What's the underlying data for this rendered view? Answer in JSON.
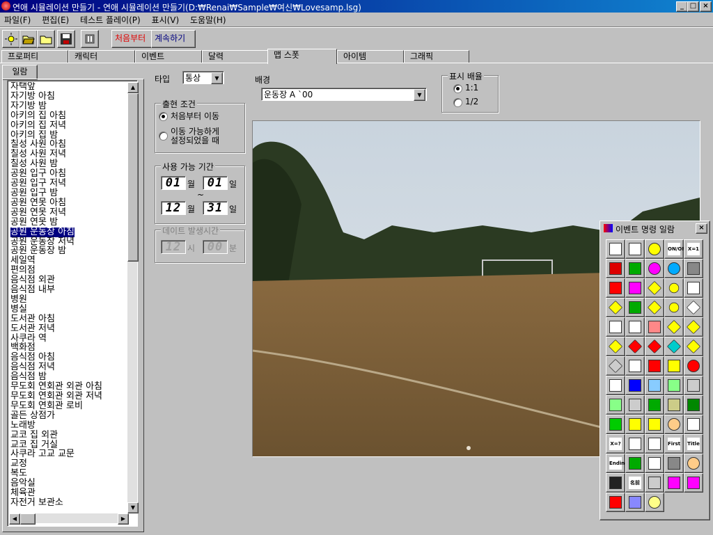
{
  "window": {
    "title": "연애 시뮬레이션 만들기 - 연애 시뮬레이션 만들기(D:₩Renai₩Sample₩여신₩Lovesamp.lsg)"
  },
  "menu": [
    "파일(F)",
    "편집(E)",
    "테스트 플레이(P)",
    "표시(V)",
    "도움말(H)"
  ],
  "toolbar": {
    "start_label": "처음부터",
    "continue_label": "계속하기"
  },
  "tabs": [
    "프로퍼티",
    "캐릭터",
    "이벤트",
    "달력",
    "맵 스폿",
    "아이템",
    "그래픽"
  ],
  "list_tab": "일람",
  "list_items": [
    "자택앞",
    "자기방 아침",
    "자기방 밤",
    "아키의 집 아침",
    "아키의 집 저녁",
    "아키의 집 밤",
    "칠성 사원 아침",
    "칠성 사원 저녁",
    "칠성 사원 밤",
    "공원 입구 아침",
    "공원 입구 저녁",
    "공원 입구 밤",
    "공원 연못 아침",
    "공원 연못 저녁",
    "공원 연못 밤",
    "공원 운동장 아침",
    "공원 운동장 저녁",
    "공원 운동장 밤",
    "세일역",
    "편의점",
    "음식점 외관",
    "음식점 내부",
    "병원",
    "병실",
    "도서관 아침",
    "도서관 저녁",
    "사쿠라 역",
    "백화점",
    "음식점 아침",
    "음식점 저녁",
    "음식점 밤",
    "무도회 연회관 외관 아침",
    "무도회 연회관 외관 저녁",
    "무도회 연회관 로비",
    "골든 상점가",
    "노래방",
    "교코 집 외관",
    "교코 집 거실",
    "사쿠라 고교 교문",
    "교정",
    "복도",
    "음악실",
    "체육관",
    "자전거 보관소"
  ],
  "selected_index": 15,
  "type": {
    "label": "타입",
    "value": "통상"
  },
  "appear": {
    "title": "출현 조건",
    "opt1": "처음부터 이동",
    "opt2a": "이동 가능하게",
    "opt2b": "설정되었을 때",
    "selected": 1
  },
  "period": {
    "title": "사용 가능 기간",
    "start_month": "01",
    "start_day": "01",
    "end_month": "12",
    "end_day": "31",
    "month_unit": "월",
    "day_unit": "일",
    "tilde": "~"
  },
  "date_time": {
    "title": "데이트 발생시간",
    "hour": "12",
    "minute": "00",
    "hour_unit": "시",
    "minute_unit": "분"
  },
  "background": {
    "label": "배경",
    "value": "운동장 A `00"
  },
  "scale": {
    "title": "표시 배율",
    "opt1": "1:1",
    "opt2": "1/2",
    "selected": 1
  },
  "event_window": {
    "title": "이벤트 명령 일람"
  },
  "event_icon_labels": {
    "onoff": "ON/OFF",
    "x1": "X=1",
    "x2": "X=?",
    "first": "First",
    "title": "Title",
    "ending": "Ending",
    "meisi": "名前"
  },
  "colors": {
    "titlebar_start": "#000080",
    "titlebar_end": "#1084d0",
    "face": "#c0c0c0",
    "toolbar_text": "#e00000",
    "selection": "#000080"
  }
}
